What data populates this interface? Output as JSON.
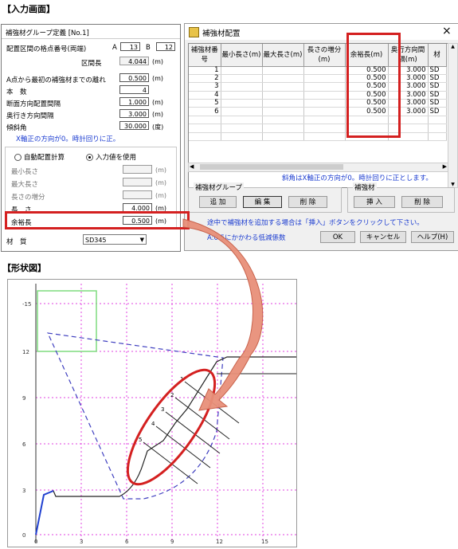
{
  "section_input_title": "【入力画面】",
  "section_shape_title": "【形状図】",
  "left_panel": {
    "title": "補強材グループ定義 [No.1]",
    "row_lattice": "配置区間の格点番号(両端)",
    "label_a": "A",
    "value_a": "13",
    "label_b": "B",
    "value_b": "12",
    "label_interval": "区間長",
    "value_interval": "4.044",
    "unit_m": "(m)",
    "label_first_dist": "A点から最初の補強材までの離れ",
    "value_first_dist": "0.500",
    "label_count": "本　数",
    "value_count": "4",
    "label_section_spacing": "断面方向配置間隔",
    "value_section_spacing": "1.000",
    "label_depth_spacing": "奥行き方向間隔",
    "value_depth_spacing": "3.000",
    "label_incline": "傾斜角",
    "value_incline": "30.000",
    "unit_deg": "(度)",
    "note": "X軸正の方向が0。時計回りに正。",
    "radio_auto": "自動配置計算",
    "radio_input": "入力値を使用",
    "label_min_len": "最小長さ",
    "label_max_len": "最大長さ",
    "label_len_inc": "長さの増分",
    "label_len": "長　さ",
    "value_len": "4.000",
    "label_margin": "余裕長",
    "value_margin": "0.500",
    "label_material": "材　質",
    "value_material": "SD345"
  },
  "dialog": {
    "title": "補強材配置",
    "close_icon": "×",
    "columns": [
      "補強材番号",
      "最小長さ(m)",
      "最大長さ(m)",
      "長さの増分(m)",
      "余裕長(m)",
      "奥行方向間隔(m)",
      "材"
    ],
    "rows": [
      {
        "no": "1",
        "margin": "0.500",
        "depth": "3.000",
        "mat": "SD"
      },
      {
        "no": "2",
        "margin": "0.500",
        "depth": "3.000",
        "mat": "SD"
      },
      {
        "no": "3",
        "margin": "0.500",
        "depth": "3.000",
        "mat": "SD"
      },
      {
        "no": "4",
        "margin": "0.500",
        "depth": "3.000",
        "mat": "SD"
      },
      {
        "no": "5",
        "margin": "0.500",
        "depth": "3.000",
        "mat": "SD"
      },
      {
        "no": "6",
        "margin": "0.500",
        "depth": "3.000",
        "mat": "SD"
      }
    ],
    "note": "斜角はX軸正の方向が0。時計回りに正とします。",
    "group_label": "補強材グループ",
    "btn_add": "追 加",
    "btn_edit": "編 集",
    "btn_delete_group": "削 除",
    "material_label": "補強材",
    "btn_insert": "挿 入",
    "btn_delete_mat": "削 除",
    "hint1": "途中で補強材を追加する場合は「挿入」ボタンをクリックして下さい。",
    "hint2": "A:0.5にかかわる低減係数",
    "btn_ok": "OK",
    "btn_cancel": "キャンセル",
    "btn_help": "ヘルプ(H)"
  },
  "chart_data": {
    "type": "line",
    "x_ticks": [
      "0",
      "3",
      "6",
      "9",
      "12",
      "15"
    ],
    "y_ticks": [
      "-15",
      "12",
      "9",
      "6",
      "3",
      "0"
    ],
    "reinforcement_labels": [
      "1",
      "2",
      "3",
      "4",
      "5"
    ]
  },
  "colors": {
    "highlight": "#d42020",
    "arrow": "#e8907a",
    "grid": "#e040e0",
    "slip": "#4040c0"
  }
}
